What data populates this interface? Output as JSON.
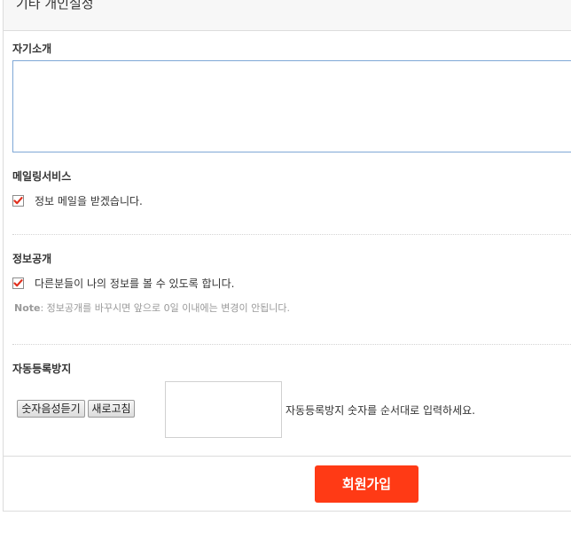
{
  "header": {
    "title": "기타 개인설정"
  },
  "bio": {
    "label": "자기소개",
    "value": ""
  },
  "mailing": {
    "label": "메일링서비스",
    "option": {
      "text": "정보 메일을 받겠습니다.",
      "checked": true
    }
  },
  "disclosure": {
    "label": "정보공개",
    "option": {
      "text": "다른분들이 나의 정보를 볼 수 있도록 합니다.",
      "checked": true
    },
    "note_label": "Note",
    "note_text": ": 정보공개를 바꾸시면 앞으로 0일 이내에는 변경이 안됩니다."
  },
  "captcha": {
    "label": "자동등록방지",
    "audio_button": "숫자음성듣기",
    "refresh_button": "새로고침",
    "help_text": "자동등록방지 숫자를 순서대로 입력하세요."
  },
  "submit": {
    "label": "회원가입",
    "color": "#ff3a15"
  },
  "colors": {
    "checkmark": "#e0301e",
    "textarea_border": "#7fa8d6"
  }
}
